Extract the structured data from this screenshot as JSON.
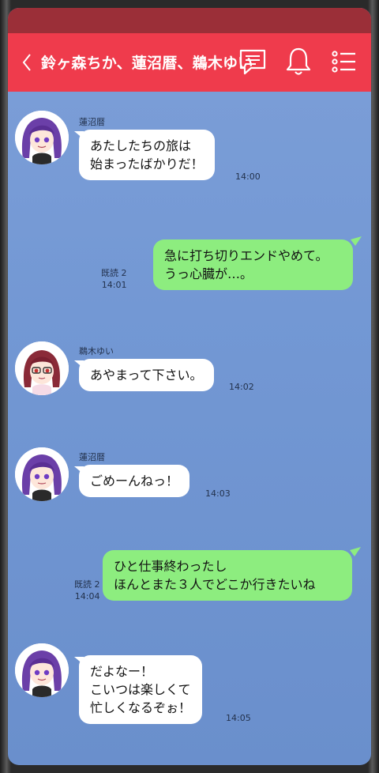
{
  "header": {
    "title": "鈴ヶ森ちか、蓮沼暦、鵜木ゆい"
  },
  "colors": {
    "header": "#ef3b4c",
    "status_strip": "#9b2f38",
    "background": "#7398d4",
    "bubble_in": "#ffffff",
    "bubble_out": "#8ded7f"
  },
  "icons": [
    "back-chevron-icon",
    "note-icon",
    "bell-icon",
    "menu-list-icon"
  ],
  "messages": [
    {
      "sender": "蓮沼暦",
      "text": "あたしたちの旅は\n始まったばかりだ！",
      "time": "14:00"
    },
    {
      "text": "急に打ち切りエンドやめて。\nうっ心臓が…。",
      "read": "既読 2",
      "time": "14:01"
    },
    {
      "sender": "鵜木ゆい",
      "text": "あやまって下さい。",
      "time": "14:02"
    },
    {
      "sender": "蓮沼暦",
      "text": "ごめーんねっ！",
      "time": "14:03"
    },
    {
      "text": "ひと仕事終わったし\nほんとまた３人でどこか行きたいね",
      "read": "既読 2",
      "time": "14:04"
    },
    {
      "sender": "蓮沼暦",
      "text": "だよなー！\nこいつは楽しくて\n忙しくなるぞぉ！",
      "time": "14:05"
    }
  ]
}
